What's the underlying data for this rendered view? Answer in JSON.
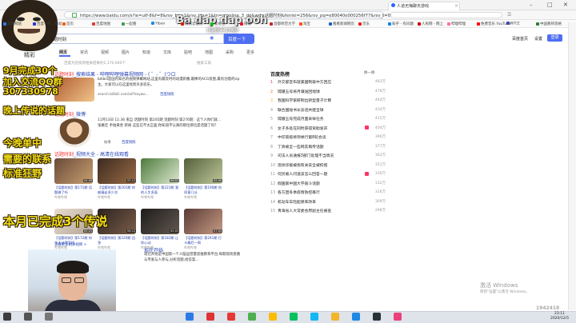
{
  "browser": {
    "tab_title": "人道无悔聊天游戏",
    "url": "https://www.baidu.com/s?ie=utf-8&f=8&rsv_bp=1&rsv_idx=1&tn=monline_3_dg&wd=话题时刻&fenlei=256&rsv_pq=e80040e000256f77&rsv_t=0ed803",
    "window_controls": [
      "–",
      "□",
      "✕"
    ],
    "bookmarks": [
      {
        "label": "常用网站",
        "color": "#2e7be6"
      },
      {
        "label": "百度一下，你就...",
        "color": "#2932e1"
      },
      {
        "label": "首页",
        "color": "#ff5a00"
      },
      {
        "label": "百度地图",
        "color": "#e53935"
      },
      {
        "label": "一起看",
        "color": "#43a047"
      },
      {
        "label": "Yiban",
        "color": "#1e88e5"
      },
      {
        "label": "网易云音乐",
        "color": "#d81e06"
      },
      {
        "label": "爱奇艺",
        "color": "#00be06"
      },
      {
        "label": "微博",
        "color": "#e6162d"
      },
      {
        "label": "首都师范大学",
        "color": "#c62828"
      },
      {
        "label": "淘宝",
        "color": "#ff5000"
      },
      {
        "label": "看看新闻网页",
        "color": "#1565c0"
      },
      {
        "label": "京东",
        "color": "#e1251b"
      },
      {
        "label": "知乎 - 有问题",
        "color": "#0084ff"
      },
      {
        "label": "人民网 - 网上",
        "color": "#c00"
      },
      {
        "label": "哔哩哔哩",
        "color": "#fb7299"
      },
      {
        "label": "免费音乐 YouTube",
        "color": "#ff0000"
      },
      {
        "label": "NTCE",
        "color": "#3949ab"
      },
      {
        "label": "中国教师资格",
        "color": "#2e7d32"
      }
    ]
  },
  "header": {
    "search_value": "话题时刻",
    "search_button": "百度一下",
    "links": [
      "设置",
      "登录"
    ],
    "extra_link": "百度首页"
  },
  "search_tabs": [
    "网页",
    "资讯",
    "视频",
    "图片",
    "知道",
    "文库",
    "贴吧",
    "地图",
    "采购",
    "更多"
  ],
  "results_count": "百度为您找到相关结果约1,170,000个",
  "search_tools": "搜索工具",
  "results": {
    "r1": {
      "title_hl": "话题时刻",
      "title_rest": "_搜索结果 - 哔哩哔哩弹幕视频网 - ( ゜- ゜)つロ",
      "snippet": "bilibili是国内知名的视频弹幕网站,这里有最及时的动漫新番,最棒的ACG氛围,最有创意的Up主。大家可以在这里找到许多欢乐。",
      "url": "search.bilibili.com/all?keywo...",
      "link": "百度快照"
    },
    "r2": {
      "title_hl": "话题时刻",
      "title_rest": "_微博",
      "snippet": "11月13日 11:36 来自 话题时刻 第205期 话题时刻 第276期：这个人你们就...",
      "snippet2": "张嘉佳 手拍黄金 新闻 这些已不太正面;你知道不认真的那位那位是话题了吗？",
      "url": "微博",
      "link": "百度快照"
    },
    "r3": {
      "title_hl": "话题时刻",
      "title_rest": "_视频大全 - 高清在线观看",
      "link": "查看更多相关视频 >"
    }
  },
  "videos": [
    {
      "title": "【话题时刻】第171期 话题做了吗",
      "src": "哔哩哔哩",
      "dur": "04:56",
      "colors": [
        "#6a4a3a",
        "#c8a070"
      ]
    },
    {
      "title": "【话题时刻】第201期 你被骗走多少次",
      "src": "哔哩哔哩",
      "dur": "05:13",
      "colors": [
        "#3a2a20",
        "#9b6b45"
      ]
    },
    {
      "title": "【话题时刻】第221期 我的人生多面",
      "src": "哔哩哔哩",
      "dur": "06:01",
      "colors": [
        "#4c7a3c",
        "#dfe9d1"
      ]
    },
    {
      "title": "【话题时刻】第190期 你同意几分",
      "src": "哔哩哔哩",
      "dur": "05:40",
      "colors": [
        "#54603a",
        "#bfc79b"
      ]
    },
    {
      "title": "【话题时刻】第172期 你今天过得怎样",
      "src": "哔哩哔哩",
      "dur": "05:22",
      "colors": [
        "#e7ddd0",
        "#b3a494"
      ]
    },
    {
      "title": "【话题时刻】第220期 回答",
      "src": "哔哩哔哩",
      "dur": "06:12",
      "colors": [
        "#2b2320",
        "#7b5d49"
      ]
    },
    {
      "title": "【话题时刻】第182期 让你心动",
      "src": "哔哩哔哩",
      "dur": "05:03",
      "colors": [
        "#1d1d1d",
        "#62574e"
      ]
    },
    {
      "title": "【话题时刻】第241期 打卡最后一周",
      "src": "哔哩哔哩",
      "dur": "07:04",
      "colors": [
        "#5a3a35",
        "#c69b84"
      ]
    }
  ],
  "r4": {
    "title": "现在开始",
    "snippet": "现在开始是中国第一个人脑运营量思维教育平台,每期现场直播与专家与人参与,分析话题,给答案..."
  },
  "hot": {
    "title": "百度热榜",
    "refresh": "换一换",
    "items": [
      {
        "idx": "1",
        "text": "外交部宣布就美国制裁中方回应",
        "num": "483万",
        "badge": false
      },
      {
        "idx": "2",
        "text": "嫦娥五号将月壤送回地球",
        "num": "478万",
        "badge": false
      },
      {
        "idx": "3",
        "text": "我国科学家研制出新型量子计算",
        "num": "464万",
        "badge": false
      },
      {
        "idx": "4",
        "text": "联合国秘书长谈话共建全球",
        "num": "434万",
        "badge": false
      },
      {
        "idx": "5",
        "text": "嫦娥五号完成月面采样任务",
        "num": "415万",
        "badge": false
      },
      {
        "idx": "6",
        "text": "女子多处在同时获得资助发声",
        "num": "404万",
        "badge": true
      },
      {
        "idx": "7",
        "text": "中印高级将领举行第8轮会谈",
        "num": "396万",
        "badge": false
      },
      {
        "idx": "8",
        "text": "丁真被全一些网友再传话题",
        "num": "377万",
        "badge": false
      },
      {
        "idx": "9",
        "text": "司法人员通报3部门处理不当情况",
        "num": "363万",
        "badge": false
      },
      {
        "idx": "10",
        "text": "澳洲华裔被指有关安全被拘留",
        "num": "351万",
        "badge": false
      },
      {
        "idx": "11",
        "text": "何炅被人问道该怎么回答一题",
        "num": "336万",
        "badge": true
      },
      {
        "idx": "12",
        "text": "假国家中国大学奋斗话题",
        "num": "332万",
        "badge": false
      },
      {
        "idx": "13",
        "text": "各方因冬季疫情防控再行",
        "num": "316万",
        "badge": false
      },
      {
        "idx": "14",
        "text": "机动车车险起保率改革",
        "num": "309万",
        "badge": false
      },
      {
        "idx": "15",
        "text": "青海省人大常委会原副主任被查",
        "num": "298万",
        "badge": false
      }
    ]
  },
  "overlay": {
    "watermark": "Ba dap dap ooh",
    "watermark2": "(视频已过期)",
    "lines": [
      {
        "text": "精彩",
        "size": 7
      },
      {
        "text": "9月完成30个",
        "size": 11
      },
      {
        "text": "加入交流QQ群",
        "size": 11
      },
      {
        "text": "307330978",
        "size": 11
      },
      {
        "text": "晚上传说的话题",
        "size": 11
      },
      {
        "text": "今晚单中",
        "size": 12
      },
      {
        "text": "需要的联系",
        "size": 12
      },
      {
        "text": "标准狂野",
        "size": 12
      },
      {
        "text": "本月已完成3个传说",
        "size": 15
      }
    ]
  },
  "windows": {
    "activate": "激活 Windows",
    "activate_sub": "转到\"设置\"以激活 Windows。",
    "corner_id": "1942418",
    "time": "23:11",
    "date": "2020/12/5"
  },
  "taskbar_icons": [
    {
      "name": "start-icon",
      "color": "#3d3d3d"
    },
    {
      "name": "search-icon",
      "color": "#555"
    },
    {
      "name": "taskview-icon",
      "color": "#777"
    },
    {
      "name": "browser-icon",
      "color": "#2c7be5"
    },
    {
      "name": "netease-icon",
      "color": "#d33"
    },
    {
      "name": "player-icon",
      "color": "#e53935"
    },
    {
      "name": "video-icon",
      "color": "#4caf50"
    },
    {
      "name": "chrome-icon",
      "color": "#fbbc05"
    },
    {
      "name": "wechat-icon",
      "color": "#07c160"
    },
    {
      "name": "qq-icon",
      "color": "#12b7f5"
    },
    {
      "name": "folder-icon",
      "color": "#f2b52b"
    },
    {
      "name": "ie-icon",
      "color": "#1e88e5"
    },
    {
      "name": "app-icon",
      "color": "#263238"
    },
    {
      "name": "music-icon",
      "color": "#ec407a"
    }
  ]
}
